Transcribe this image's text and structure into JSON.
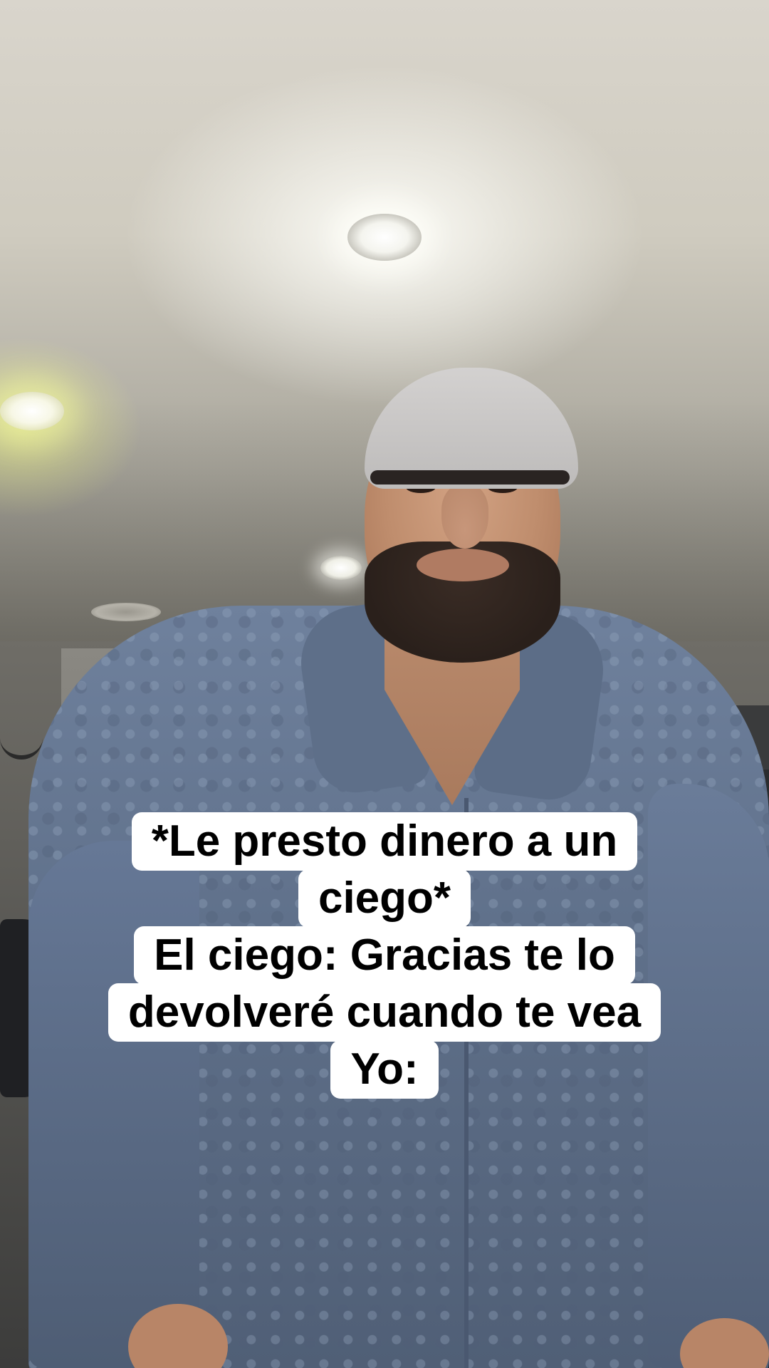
{
  "caption": {
    "lines": [
      "*Le presto dinero a un",
      "ciego*",
      "El ciego: Gracias te lo",
      "devolveré cuando te vea",
      "Yo:"
    ]
  },
  "colors": {
    "caption_background": "#ffffff",
    "caption_text": "#000000",
    "jacket": "#60718b",
    "cap": "#c8c6c5"
  }
}
